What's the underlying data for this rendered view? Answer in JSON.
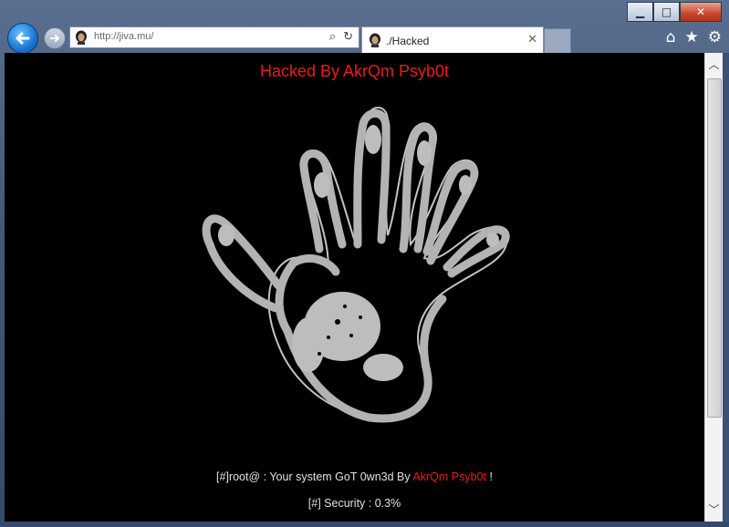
{
  "browser": {
    "address_url": "http://jiva.mu/",
    "tab_title": "./Hacked",
    "colors": {
      "frame": "#44597c",
      "back_button": "#1976d2",
      "close_button": "#c9452c"
    }
  },
  "page": {
    "headline": "Hacked By AkrQm Psyb0t",
    "line1_prefix": "[#]root@ : Your system GoT 0wn3d By ",
    "line1_name": "AkrQm Psyb0t",
    "line1_suffix": " !",
    "line2": "[#] Security : 0.3%",
    "colors": {
      "background": "#000000",
      "accent": "#e81c1c",
      "text": "#e0e0e0"
    }
  },
  "icons": {
    "back": "arrow-left-icon",
    "forward": "arrow-right-icon",
    "search": "search-icon",
    "refresh": "refresh-icon",
    "home": "home-icon",
    "favorites": "star-icon",
    "settings": "gear-icon"
  }
}
